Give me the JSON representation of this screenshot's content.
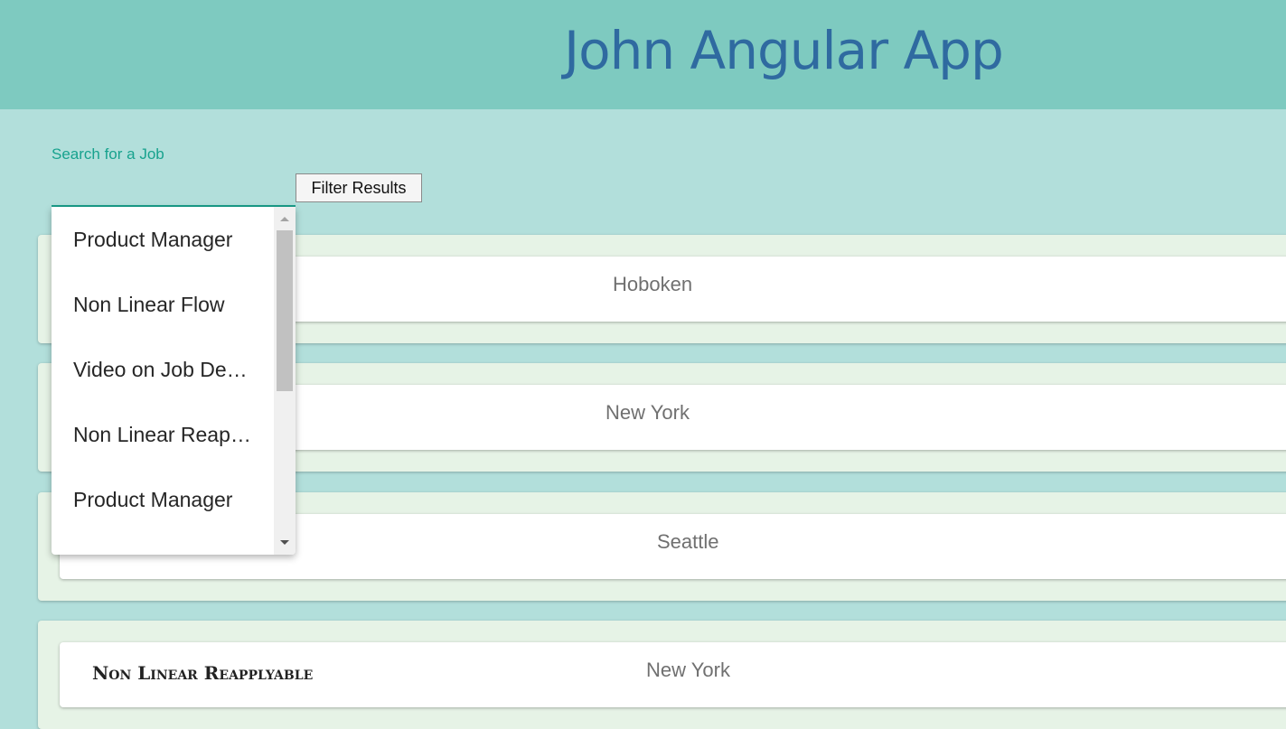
{
  "header": {
    "title": "John Angular App"
  },
  "search": {
    "label": "Search for a Job",
    "filter_button": "Filter Results"
  },
  "jobs": [
    {
      "title": "",
      "location": "Hoboken"
    },
    {
      "title": "",
      "location": "New York"
    },
    {
      "title": "",
      "location": "Seattle"
    },
    {
      "title": "Non Linear Reapplyable",
      "location": "New York"
    }
  ],
  "dropdown": {
    "options": [
      "Product Manager",
      "Non Linear Flow",
      "Video on Job Description",
      "Non Linear Reapplyable",
      "Product Manager"
    ]
  },
  "colors": {
    "header_bg": "#7ecac0",
    "page_bg": "#b2dfdb",
    "title_color": "#2f6aa0",
    "accent": "#17a28e",
    "card_bg": "#e6f3e6"
  }
}
